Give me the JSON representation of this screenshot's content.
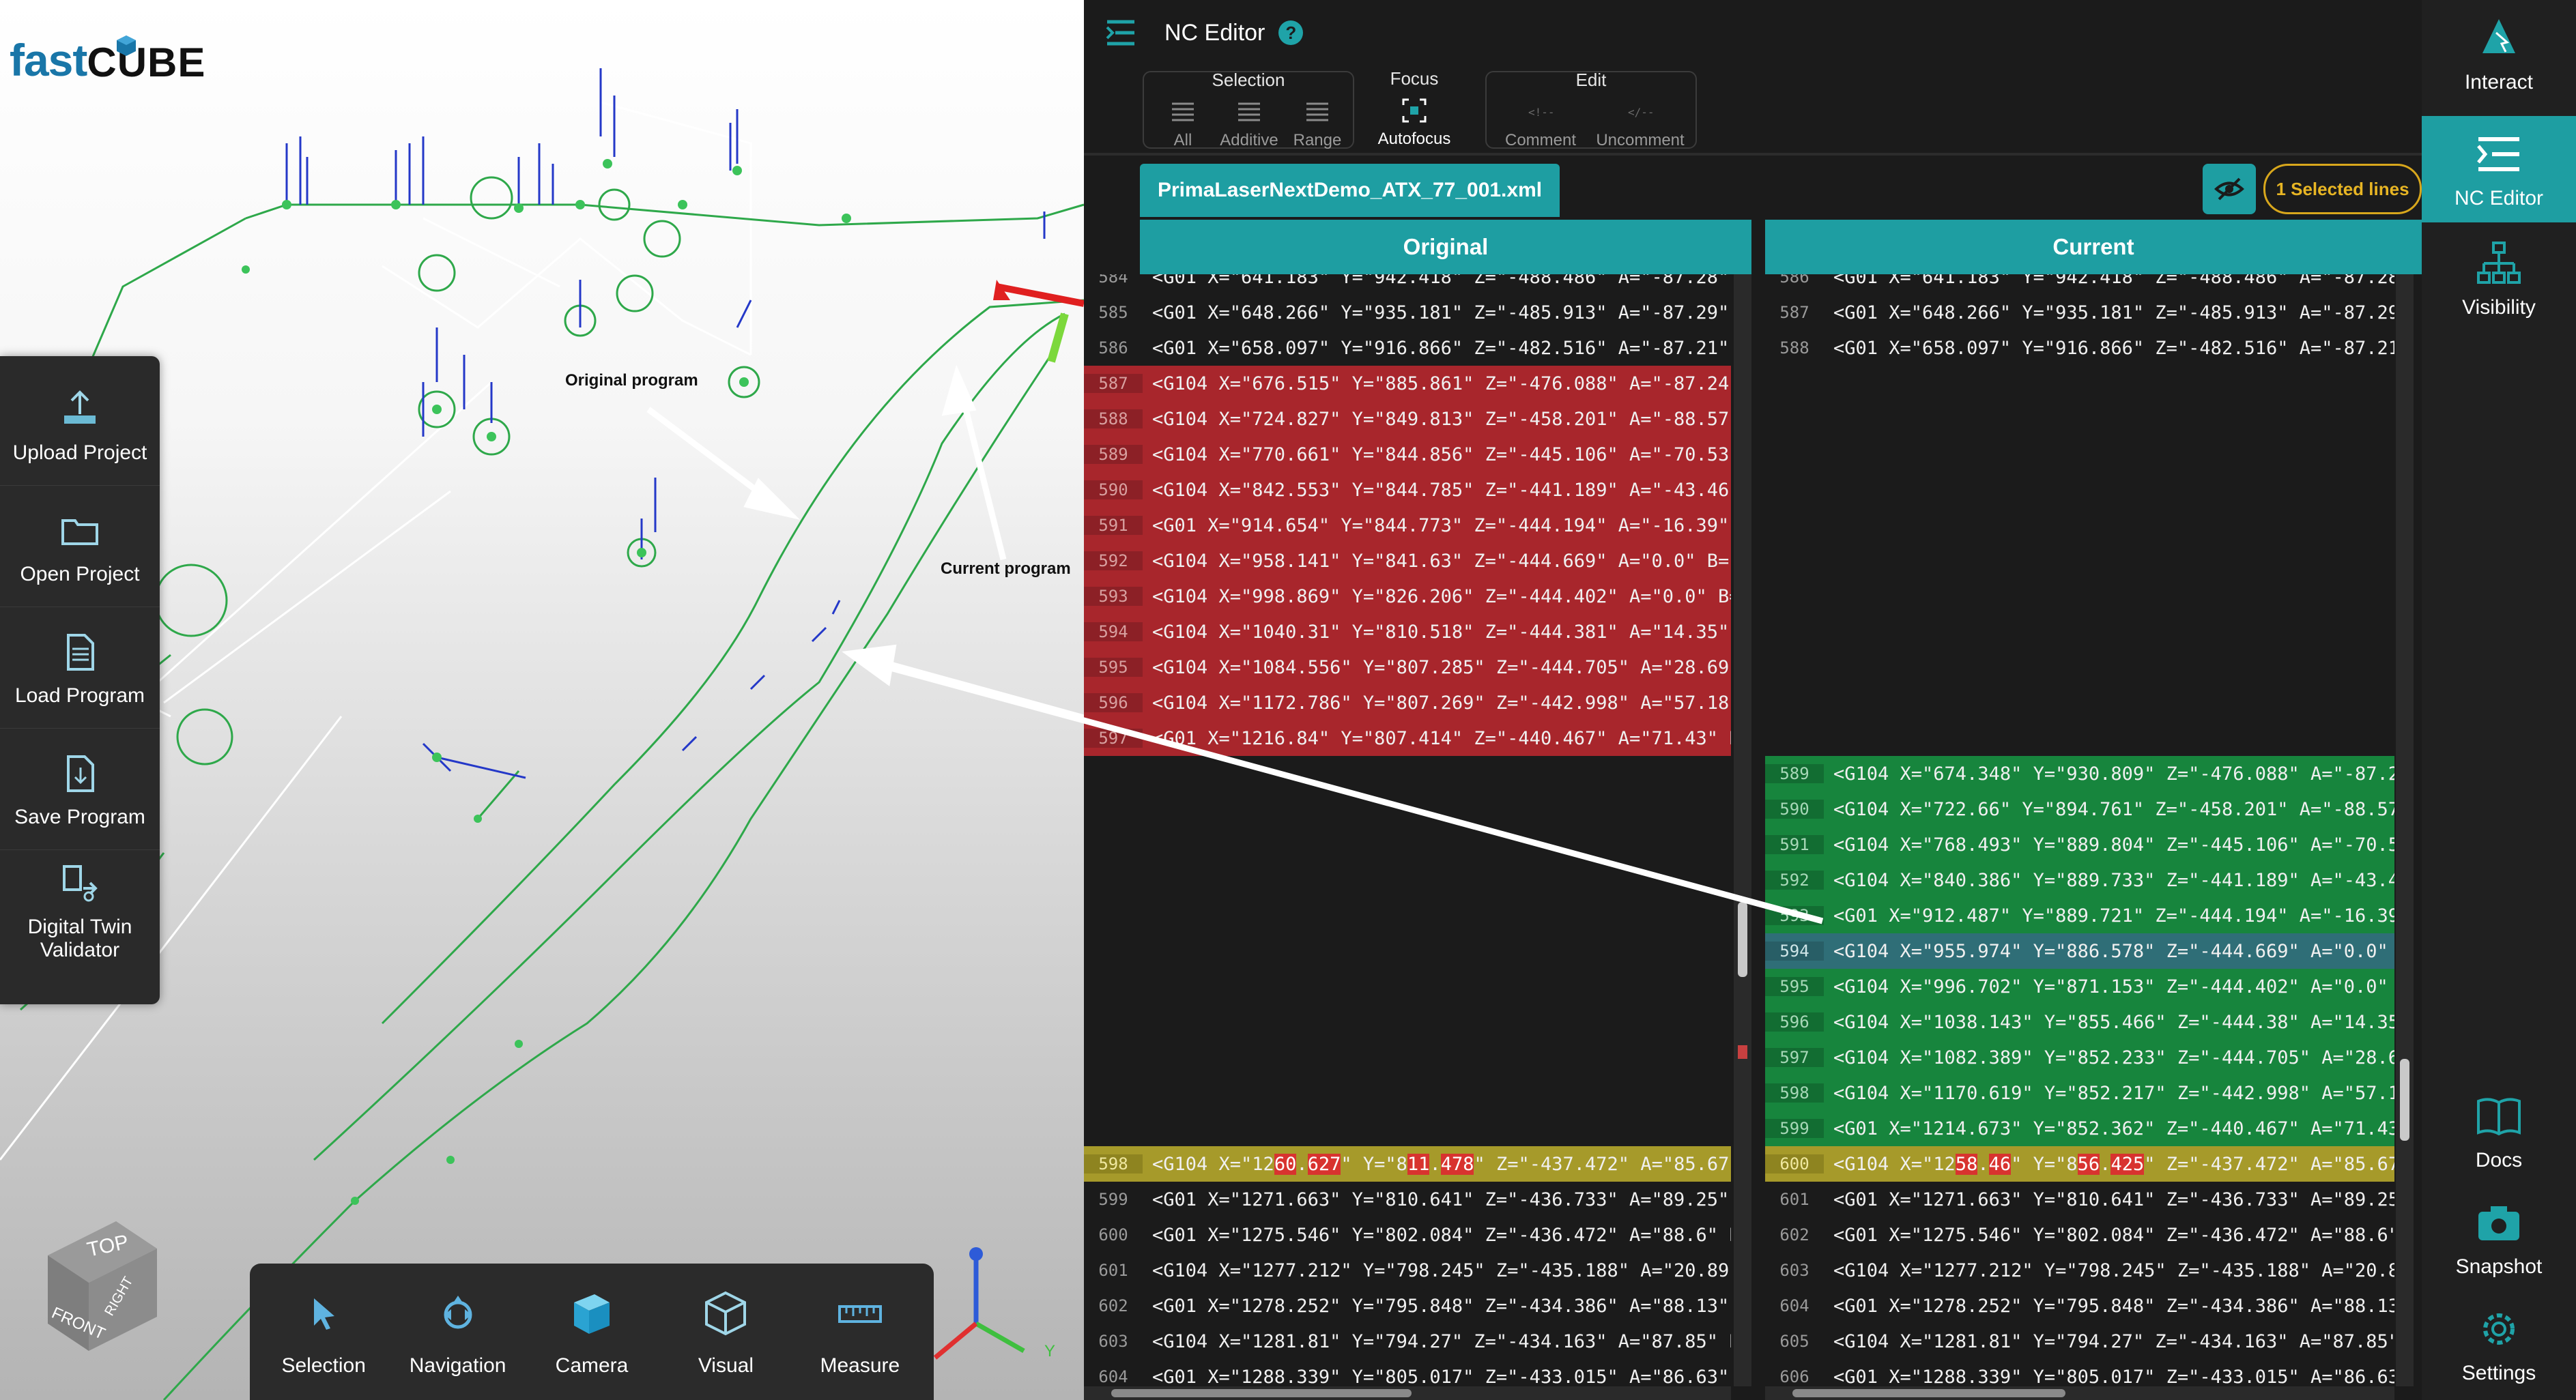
{
  "app": {
    "logo_fast": "fast",
    "logo_cube": "CUBE"
  },
  "left_toolbar": [
    {
      "label": "Upload Project",
      "icon": "upload-icon"
    },
    {
      "label": "Open Project",
      "icon": "folder-icon"
    },
    {
      "label": "Load Program",
      "icon": "document-icon"
    },
    {
      "label": "Save Program",
      "icon": "save-file-icon"
    },
    {
      "label": "Digital Twin Validator",
      "icon": "digital-twin-icon"
    }
  ],
  "viewport": {
    "annotation_original": "Original program",
    "annotation_current": "Current program",
    "navcube": {
      "top": "TOP",
      "front": "FRONT",
      "right": "RIGHT"
    },
    "axis_y": "Y"
  },
  "bottom_toolbar": [
    {
      "label": "Selection",
      "icon": "cursor-icon"
    },
    {
      "label": "Navigation",
      "icon": "navigation-icon"
    },
    {
      "label": "Camera",
      "icon": "camera-cube-icon"
    },
    {
      "label": "Visual",
      "icon": "visual-cube-icon"
    },
    {
      "label": "Measure",
      "icon": "ruler-icon"
    }
  ],
  "editor": {
    "title": "NC Editor",
    "help": "?",
    "groups": {
      "selection": {
        "title": "Selection",
        "buttons": [
          "All",
          "Additive",
          "Range"
        ]
      },
      "focus": {
        "title": "Focus",
        "buttons": [
          "Autofocus"
        ]
      },
      "edit": {
        "title": "Edit",
        "buttons": [
          "Comment",
          "Uncomment"
        ]
      }
    },
    "file_tab": "PrimaLaserNextDemo_ATX_77_001.xml",
    "selected_badge": "1 Selected lines",
    "col_original": "Original",
    "col_current": "Current"
  },
  "original_lines": [
    {
      "n": "584",
      "t": "<G01 X=\"641.183\" Y=\"942.418\" Z=\"-488.486\" A=\"-87.28\" B",
      "k": "normal"
    },
    {
      "n": "585",
      "t": "<G01 X=\"648.266\" Y=\"935.181\" Z=\"-485.913\" A=\"-87.29\" B",
      "k": "normal"
    },
    {
      "n": "586",
      "t": "<G01 X=\"658.097\" Y=\"916.866\" Z=\"-482.516\" A=\"-87.21\" B",
      "k": "normal"
    },
    {
      "n": "587",
      "t": "<G104 X=\"676.515\" Y=\"885.861\" Z=\"-476.088\" A=\"-87.24\" B",
      "k": "removed"
    },
    {
      "n": "588",
      "t": "<G104 X=\"724.827\" Y=\"849.813\" Z=\"-458.201\" A=\"-88.57\" B",
      "k": "removed"
    },
    {
      "n": "589",
      "t": "<G104 X=\"770.661\" Y=\"844.856\" Z=\"-445.106\" A=\"-70.53\" B",
      "k": "removed"
    },
    {
      "n": "590",
      "t": "<G104 X=\"842.553\" Y=\"844.785\" Z=\"-441.189\" A=\"-43.46\" B",
      "k": "removed"
    },
    {
      "n": "591",
      "t": "<G01 X=\"914.654\" Y=\"844.773\" Z=\"-444.194\" A=\"-16.39\" B",
      "k": "removed"
    },
    {
      "n": "592",
      "t": "<G104 X=\"958.141\" Y=\"841.63\" Z=\"-444.669\" A=\"0.0\" B=\"-6",
      "k": "removed"
    },
    {
      "n": "593",
      "t": "<G104 X=\"998.869\" Y=\"826.206\" Z=\"-444.402\" A=\"0.0\" B=\"-",
      "k": "removed"
    },
    {
      "n": "594",
      "t": "<G104 X=\"1040.31\" Y=\"810.518\" Z=\"-444.381\" A=\"14.35\" B",
      "k": "removed"
    },
    {
      "n": "595",
      "t": "<G104 X=\"1084.556\" Y=\"807.285\" Z=\"-444.705\" A=\"28.69\" B",
      "k": "removed"
    },
    {
      "n": "596",
      "t": "<G104 X=\"1172.786\" Y=\"807.269\" Z=\"-442.998\" A=\"57.18\" B",
      "k": "removed"
    },
    {
      "n": "597",
      "t": "<G01 X=\"1216.84\" Y=\"807.414\" Z=\"-440.467\" A=\"71.43\" B=",
      "k": "removed"
    },
    {
      "n": "",
      "t": "",
      "k": "empty"
    },
    {
      "n": "",
      "t": "",
      "k": "empty"
    },
    {
      "n": "",
      "t": "",
      "k": "empty"
    },
    {
      "n": "",
      "t": "",
      "k": "empty"
    },
    {
      "n": "",
      "t": "",
      "k": "empty"
    },
    {
      "n": "",
      "t": "",
      "k": "empty"
    },
    {
      "n": "",
      "t": "",
      "k": "empty"
    },
    {
      "n": "",
      "t": "",
      "k": "empty"
    },
    {
      "n": "",
      "t": "",
      "k": "empty"
    },
    {
      "n": "",
      "t": "",
      "k": "empty"
    },
    {
      "n": "",
      "t": "",
      "k": "empty"
    },
    {
      "n": "598",
      "t": "",
      "k": "modified",
      "parts": [
        "<G104 X=\"12",
        "60",
        ".",
        "627",
        "\" Y=\"8",
        "11",
        ".",
        "478",
        "\" Z=\"-437.472\" A=\"85.67\""
      ]
    },
    {
      "n": "599",
      "t": "<G01 X=\"1271.663\" Y=\"810.641\" Z=\"-436.733\" A=\"89.25\" B",
      "k": "normal"
    },
    {
      "n": "600",
      "t": "<G01 X=\"1275.546\" Y=\"802.084\" Z=\"-436.472\" A=\"88.6\" B",
      "k": "normal"
    },
    {
      "n": "601",
      "t": "<G104 X=\"1277.212\" Y=\"798.245\" Z=\"-435.188\" A=\"20.89\" B",
      "k": "normal"
    },
    {
      "n": "602",
      "t": "<G01 X=\"1278.252\" Y=\"795.848\" Z=\"-434.386\" A=\"88.13\" B",
      "k": "normal"
    },
    {
      "n": "603",
      "t": "<G104 X=\"1281.81\" Y=\"794.27\" Z=\"-434.163\" A=\"87.85\" B=",
      "k": "normal"
    },
    {
      "n": "604",
      "t": "<G01 X=\"1288.339\" Y=\"805.017\" Z=\"-433.015\" A=\"86.63\" B",
      "k": "normal"
    }
  ],
  "current_lines": [
    {
      "n": "586",
      "t": "<G01 X=\"641.183\" Y=\"942.418\" Z=\"-488.486\" A=\"-87.28\" B",
      "k": "normal"
    },
    {
      "n": "587",
      "t": "<G01 X=\"648.266\" Y=\"935.181\" Z=\"-485.913\" A=\"-87.29\" B",
      "k": "normal"
    },
    {
      "n": "588",
      "t": "<G01 X=\"658.097\" Y=\"916.866\" Z=\"-482.516\" A=\"-87.21\" B",
      "k": "normal"
    },
    {
      "n": "",
      "t": "",
      "k": "empty"
    },
    {
      "n": "",
      "t": "",
      "k": "empty"
    },
    {
      "n": "",
      "t": "",
      "k": "empty"
    },
    {
      "n": "",
      "t": "",
      "k": "empty"
    },
    {
      "n": "",
      "t": "",
      "k": "empty"
    },
    {
      "n": "",
      "t": "",
      "k": "empty"
    },
    {
      "n": "",
      "t": "",
      "k": "empty"
    },
    {
      "n": "",
      "t": "",
      "k": "empty"
    },
    {
      "n": "",
      "t": "",
      "k": "empty"
    },
    {
      "n": "",
      "t": "",
      "k": "empty"
    },
    {
      "n": "",
      "t": "",
      "k": "empty"
    },
    {
      "n": "589",
      "t": "<G104 X=\"674.348\" Y=\"930.809\" Z=\"-476.088\" A=\"-87.24\" B",
      "k": "added"
    },
    {
      "n": "590",
      "t": "<G104 X=\"722.66\" Y=\"894.761\" Z=\"-458.201\" A=\"-88.57\" B",
      "k": "added"
    },
    {
      "n": "591",
      "t": "<G104 X=\"768.493\" Y=\"889.804\" Z=\"-445.106\" A=\"-70.53\" B",
      "k": "added"
    },
    {
      "n": "592",
      "t": "<G104 X=\"840.386\" Y=\"889.733\" Z=\"-441.189\" A=\"-43.46\" B",
      "k": "added"
    },
    {
      "n": "593",
      "t": "<G01 X=\"912.487\" Y=\"889.721\" Z=\"-444.194\" A=\"-16.39\" B",
      "k": "added"
    },
    {
      "n": "594",
      "t": "<G104 X=\"955.974\" Y=\"886.578\" Z=\"-444.669\" A=\"0.0\" B=",
      "k": "selected"
    },
    {
      "n": "595",
      "t": "<G104 X=\"996.702\" Y=\"871.153\" Z=\"-444.402\" A=\"0.0\" B=",
      "k": "added"
    },
    {
      "n": "596",
      "t": "<G104 X=\"1038.143\" Y=\"855.466\" Z=\"-444.38\" A=\"14.35\" B",
      "k": "added"
    },
    {
      "n": "597",
      "t": "<G104 X=\"1082.389\" Y=\"852.233\" Z=\"-444.705\" A=\"28.69\" B",
      "k": "added"
    },
    {
      "n": "598",
      "t": "<G104 X=\"1170.619\" Y=\"852.217\" Z=\"-442.998\" A=\"57.18\" B",
      "k": "added"
    },
    {
      "n": "599",
      "t": "<G01 X=\"1214.673\" Y=\"852.362\" Z=\"-440.467\" A=\"71.43\" B",
      "k": "added"
    },
    {
      "n": "600",
      "t": "",
      "k": "modified",
      "parts": [
        "<G104 X=\"12",
        "58",
        ".",
        "46",
        "\" Y=\"8",
        "56",
        ".",
        "425",
        "\" Z=\"-437.472\" A=\"85.67\""
      ]
    },
    {
      "n": "601",
      "t": "<G01 X=\"1271.663\" Y=\"810.641\" Z=\"-436.733\" A=\"89.25\" B",
      "k": "normal"
    },
    {
      "n": "602",
      "t": "<G01 X=\"1275.546\" Y=\"802.084\" Z=\"-436.472\" A=\"88.6\" B",
      "k": "normal"
    },
    {
      "n": "603",
      "t": "<G104 X=\"1277.212\" Y=\"798.245\" Z=\"-435.188\" A=\"20.89\" B",
      "k": "normal"
    },
    {
      "n": "604",
      "t": "<G01 X=\"1278.252\" Y=\"795.848\" Z=\"-434.386\" A=\"88.13\" B",
      "k": "normal"
    },
    {
      "n": "605",
      "t": "<G104 X=\"1281.81\" Y=\"794.27\" Z=\"-434.163\" A=\"87.85\" B=",
      "k": "normal"
    },
    {
      "n": "606",
      "t": "<G01 X=\"1288.339\" Y=\"805.017\" Z=\"-433.015\" A=\"86.63\" B",
      "k": "normal"
    }
  ],
  "right_sidebar": [
    {
      "label": "Interact",
      "icon": "interact-icon"
    },
    {
      "label": "NC Editor",
      "icon": "nc-editor-icon"
    },
    {
      "label": "Visibility",
      "icon": "hierarchy-icon"
    },
    {
      "label": "Docs",
      "icon": "book-icon"
    },
    {
      "label": "Snapshot",
      "icon": "camera-icon"
    },
    {
      "label": "Settings",
      "icon": "gear-icon"
    }
  ],
  "colors": {
    "teal": "#1e9ea2",
    "removed": "#a8262c",
    "added": "#17853d",
    "modified": "#a69a2a",
    "selected": "#2f6e77",
    "badge": "#e7b524"
  }
}
